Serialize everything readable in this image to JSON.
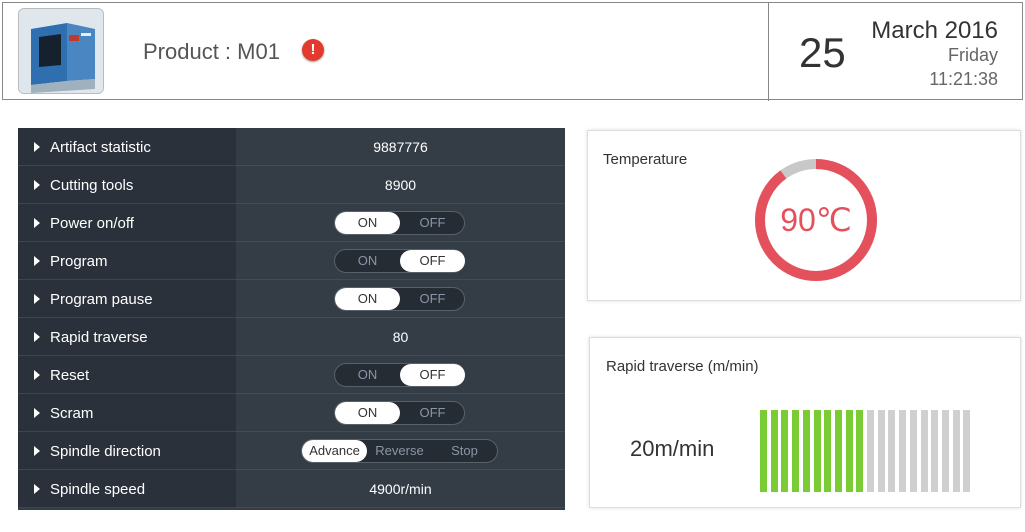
{
  "header": {
    "product_label": "Product : M01",
    "day": "25",
    "month_year": "March 2016",
    "weekday": "Friday",
    "time": "11:21:38"
  },
  "rows": [
    {
      "label": "Artifact statistic",
      "type": "value",
      "value": "9887776"
    },
    {
      "label": "Cutting tools",
      "type": "value",
      "value": "8900"
    },
    {
      "label": "Power on/off",
      "type": "toggle",
      "options": [
        "ON",
        "OFF"
      ],
      "selected": "ON"
    },
    {
      "label": "Program",
      "type": "toggle",
      "options": [
        "ON",
        "OFF"
      ],
      "selected": "OFF"
    },
    {
      "label": "Program pause",
      "type": "toggle",
      "options": [
        "ON",
        "OFF"
      ],
      "selected": "ON"
    },
    {
      "label": "Rapid traverse",
      "type": "value",
      "value": "80"
    },
    {
      "label": "Reset",
      "type": "toggle",
      "options": [
        "ON",
        "OFF"
      ],
      "selected": "OFF"
    },
    {
      "label": "Scram",
      "type": "toggle",
      "options": [
        "ON",
        "OFF"
      ],
      "selected": "ON"
    },
    {
      "label": "Spindle direction",
      "type": "toggle3",
      "options": [
        "Advance",
        "Reverse",
        "Stop"
      ],
      "selected": "Advance"
    },
    {
      "label": "Spindle speed",
      "type": "value",
      "value": "4900r/min"
    }
  ],
  "temperature": {
    "title": "Temperature",
    "value_text": "90℃",
    "fraction": 0.9,
    "color": "#e4515c",
    "track_color": "#c8c8c8"
  },
  "rapid_traverse": {
    "title": "Rapid traverse (m/min)",
    "value_text": "20m/min",
    "segments_total": 20,
    "segments_active": 10,
    "active_color": "#7acc35",
    "inactive_color": "#cfcfcf"
  }
}
